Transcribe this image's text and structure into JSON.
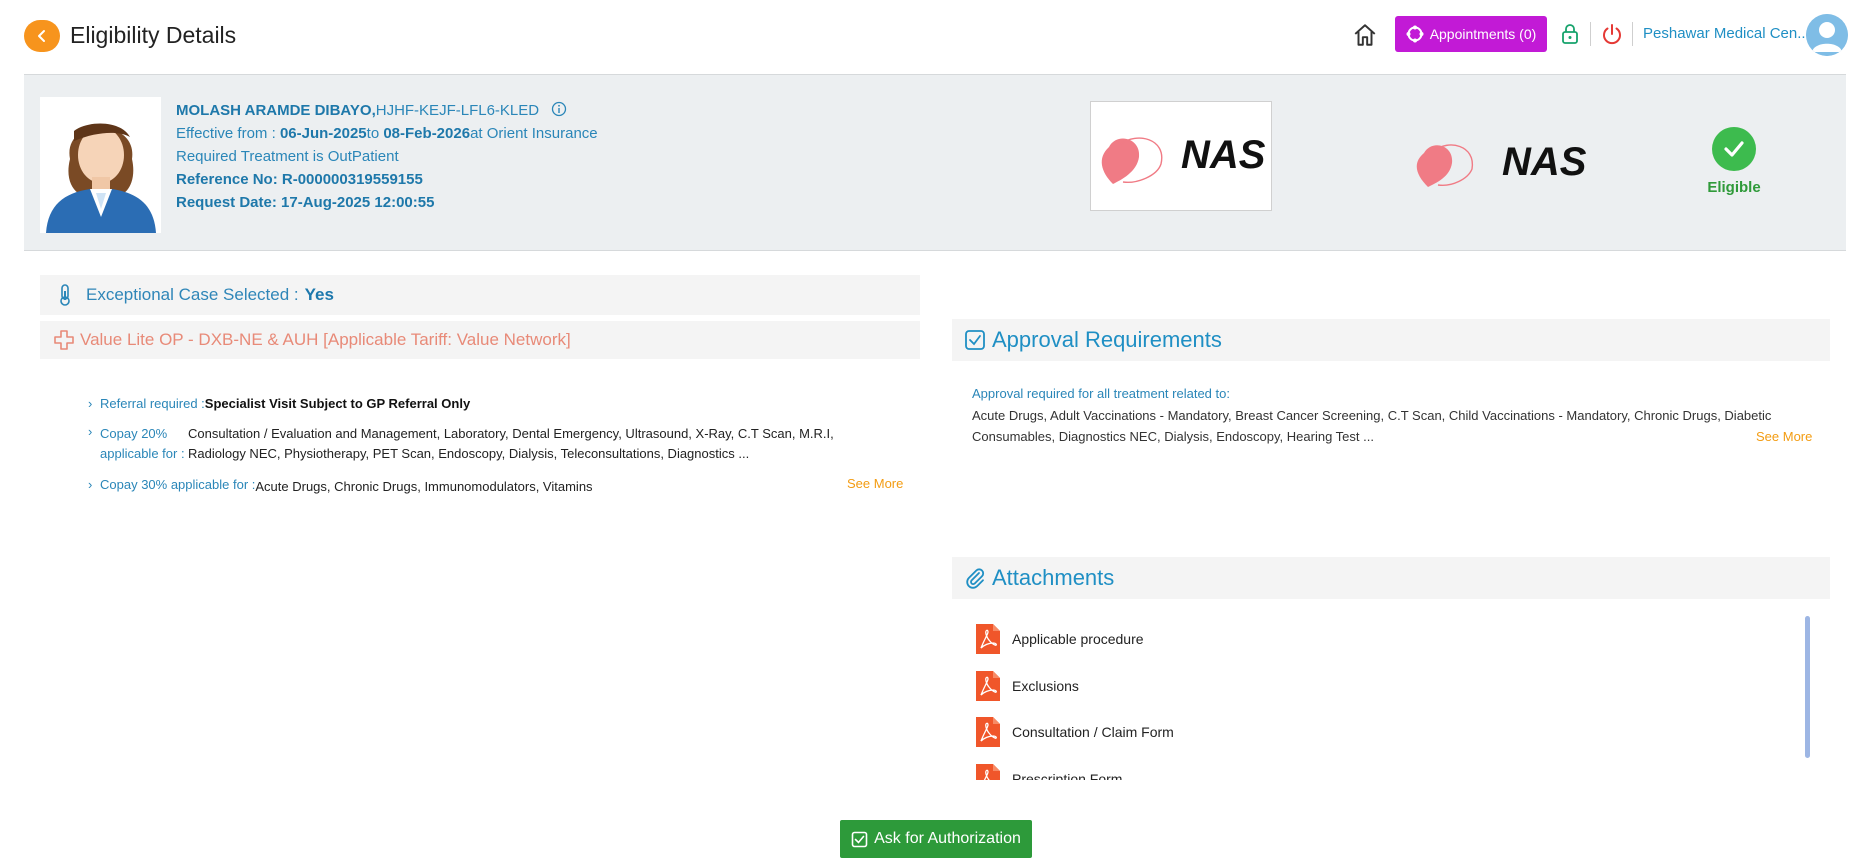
{
  "header": {
    "title": "Eligibility Details",
    "appointments_label": "Appointments (0)",
    "facility_name": "Peshawar Medical Cen..."
  },
  "patient": {
    "name": "MOLASH ARAMDE DIBAYO,",
    "id": "HJHF-KEJF-LFL6-KLED",
    "effective_prefix": "Effective from : ",
    "effective_from": "06-Jun-2025",
    "effective_to_prefix": "to ",
    "effective_to": "08-Feb-2026",
    "insurer_text": "at Orient Insurance",
    "treatment_line": "Required Treatment is OutPatient",
    "reference_line": "Reference No: R-000000319559155",
    "request_date_line": "Request Date: 17-Aug-2025 12:00:55",
    "status_label": "Eligible",
    "status_color": "#3dbb4e"
  },
  "logos": {
    "payer_logo_text": "NAS",
    "tpa_logo_text": "NAS"
  },
  "exceptional_case": {
    "label": "Exceptional Case Selected :",
    "value": "Yes"
  },
  "plan": {
    "label": "Value Lite OP - DXB-NE & AUH [Applicable Tariff: Value Network]"
  },
  "benefits": {
    "referral_label": "Referral required :",
    "referral_value": "Specialist Visit Subject to GP Referral Only",
    "copay20_label": "Copay 20% applicable for :",
    "copay20_text": "Consultation / Evaluation and Management, Laboratory, Dental Emergency, Ultrasound, X-Ray, C.T Scan, M.R.I, Radiology NEC, Physiotherapy, PET Scan, Endoscopy, Dialysis, Teleconsultations, Diagnostics ...",
    "see_more": "See More",
    "copay30_label": "Copay 30% applicable for :",
    "copay30_text": "Acute Drugs, Chronic Drugs, Immunomodulators, Vitamins"
  },
  "approval": {
    "title": "Approval Requirements",
    "heading": "Approval required for all treatment related to:",
    "text": "Acute Drugs, Adult Vaccinations - Mandatory, Breast Cancer Screening, C.T Scan, Child Vaccinations - Mandatory, Chronic Drugs, Diabetic Consumables, Diagnostics NEC, Dialysis, Endoscopy, Hearing Test ...",
    "see_more": "See More"
  },
  "attachments": {
    "title": "Attachments",
    "items": [
      {
        "label": "Applicable procedure",
        "icon": "pdf-icon"
      },
      {
        "label": "Exclusions",
        "icon": "pdf-icon"
      },
      {
        "label": "Consultation / Claim Form",
        "icon": "pdf-icon"
      },
      {
        "label": "Prescription Form",
        "icon": "pdf-icon"
      }
    ]
  },
  "actions": {
    "ask_authorization": "Ask for Authorization"
  },
  "colors": {
    "accent": "#1f8fc4",
    "orange": "#f7941d",
    "appointments": "#c21ad6",
    "success": "#2d9a3a",
    "see_more": "#f39c12",
    "pdf": "#f0562a"
  }
}
